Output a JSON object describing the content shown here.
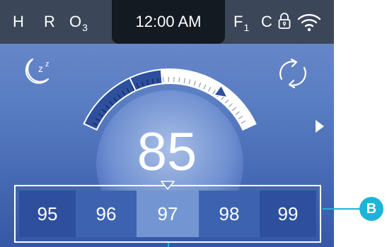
{
  "status_bar": {
    "h_label": "H",
    "r_label": "R",
    "o3_label": "O",
    "o3_sub": "3",
    "f1_label": "F",
    "f1_sub": "1",
    "c_label": "C",
    "lock_icon": "lock-icon",
    "wifi_icon": "wifi-icon"
  },
  "clock": {
    "time": "12:00 AM"
  },
  "mode_icons": {
    "left": "sleep-moon-icon",
    "right": "refresh-cycle-icon",
    "next": "play-arrow-icon"
  },
  "dial": {
    "temperature": "85",
    "fill_fraction": 0.46,
    "set_point_fraction": 0.78
  },
  "selector": {
    "options": [
      "95",
      "96",
      "97",
      "98",
      "99"
    ],
    "selected": "97"
  },
  "callout": {
    "label": "B"
  },
  "colors": {
    "status_bar": "#3b4659",
    "clock_bg": "#141a22",
    "dial_fill": "#2d4f9d",
    "accent": "#1cb5d8"
  }
}
